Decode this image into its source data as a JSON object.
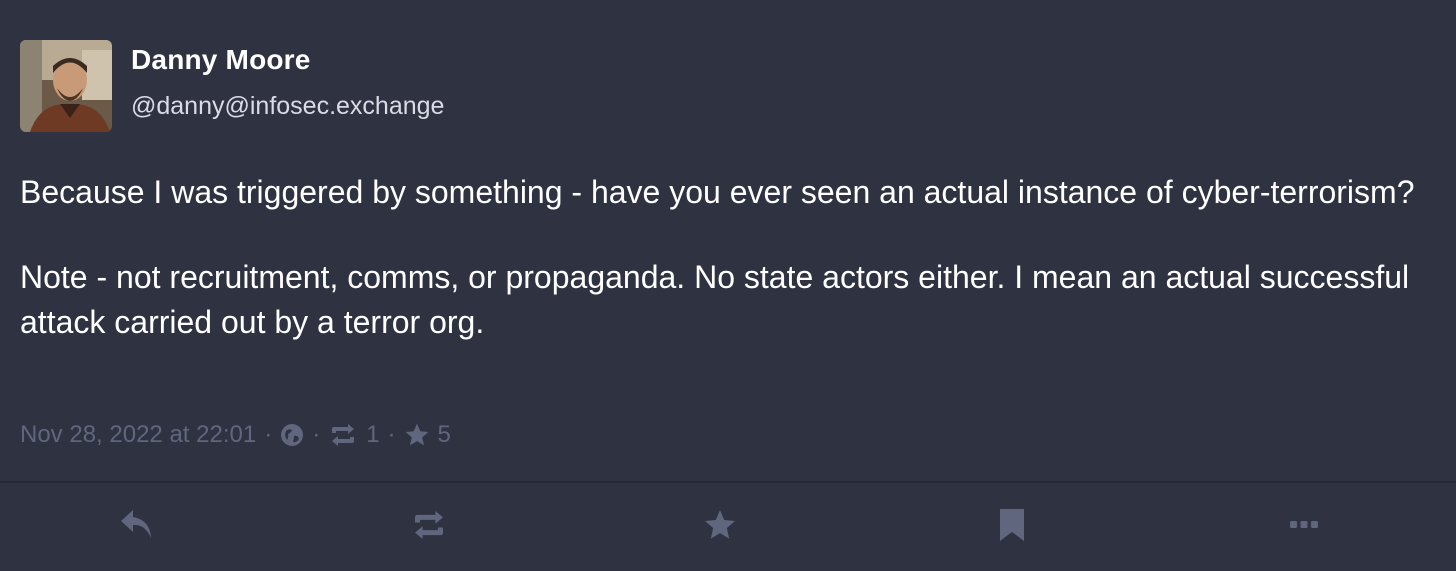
{
  "author": {
    "display_name": "Danny Moore",
    "handle": "@danny@infosec.exchange",
    "avatar_icon": "user-avatar-photo"
  },
  "post": {
    "paragraphs": [
      "Because I was triggered by something - have you ever seen an actual instance of cyber-terrorism?",
      "Note - not recruitment, comms, or propaganda. No state actors either. I mean an actual successful attack carried out by a terror org."
    ]
  },
  "meta": {
    "timestamp": "Nov 28, 2022 at 22:01",
    "separator": "·",
    "visibility_icon": "globe-icon",
    "boost_icon": "retweet-icon",
    "boosts": "1",
    "favourite_icon": "star-icon",
    "favourites": "5"
  },
  "actions": {
    "reply_icon": "reply-icon",
    "boost_icon": "retweet-icon",
    "favourite_icon": "star-icon",
    "bookmark_icon": "bookmark-icon",
    "more_icon": "ellipsis-icon"
  },
  "colors": {
    "background": "#2f3240",
    "text_primary": "#ffffff",
    "text_secondary": "#d9dce6",
    "text_muted": "#5f667e",
    "action_icon": "#5f667e"
  }
}
